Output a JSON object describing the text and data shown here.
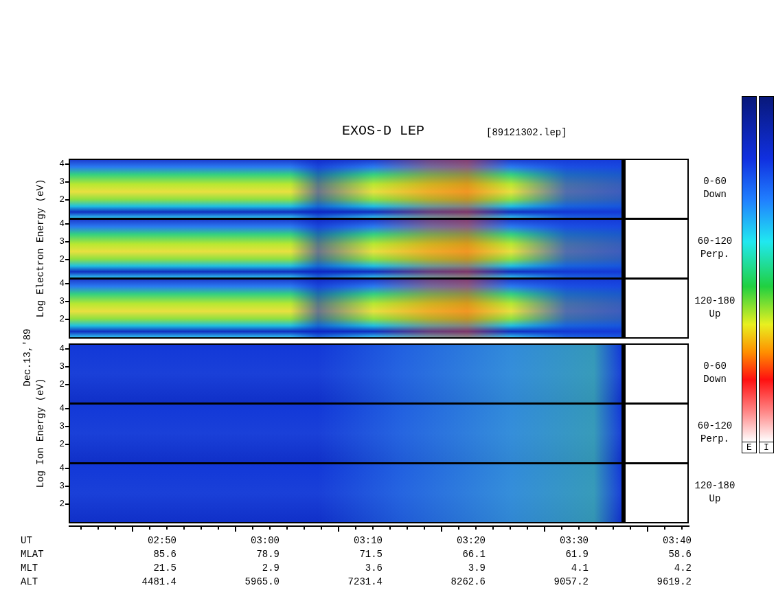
{
  "title": "EXOS-D LEP",
  "file_label": "[89121302.lep]",
  "groups": [
    {
      "kind": "electron",
      "axis_label": "Log Electron Energy (eV)",
      "panels": [
        {
          "ticks": [
            "4",
            "3",
            "2"
          ],
          "range": "0-60",
          "direction": "Down"
        },
        {
          "ticks": [
            "4",
            "3",
            "2"
          ],
          "range": "60-120",
          "direction": "Perp."
        },
        {
          "ticks": [
            "4",
            "3",
            "2"
          ],
          "range": "120-180",
          "direction": "Up"
        }
      ]
    },
    {
      "kind": "ion",
      "axis_label": "Log Ion Energy (eV)",
      "panels": [
        {
          "ticks": [
            "4",
            "3",
            "2"
          ],
          "range": "0-60",
          "direction": "Down"
        },
        {
          "ticks": [
            "4",
            "3",
            "2"
          ],
          "range": "60-120",
          "direction": "Perp."
        },
        {
          "ticks": [
            "4",
            "3",
            "2"
          ],
          "range": "120-180",
          "direction": "Up"
        }
      ]
    }
  ],
  "date_label": "Dec.13,'89",
  "color_bars": [
    {
      "label": "E"
    },
    {
      "label": "I"
    }
  ],
  "time_rows": [
    {
      "label": "UT",
      "values": [
        "02:50",
        "03:00",
        "03:10",
        "03:20",
        "03:30",
        "03:40"
      ]
    },
    {
      "label": "MLAT",
      "values": [
        "85.6",
        "78.9",
        "71.5",
        "66.1",
        "61.9",
        "58.6"
      ]
    },
    {
      "label": "MLT",
      "values": [
        "21.5",
        "2.9",
        "3.6",
        "3.9",
        "4.1",
        "4.2"
      ]
    },
    {
      "label": "ALT",
      "values": [
        "4481.4",
        "5965.0",
        "7231.4",
        "8262.6",
        "9057.2",
        "9619.2"
      ]
    }
  ]
}
